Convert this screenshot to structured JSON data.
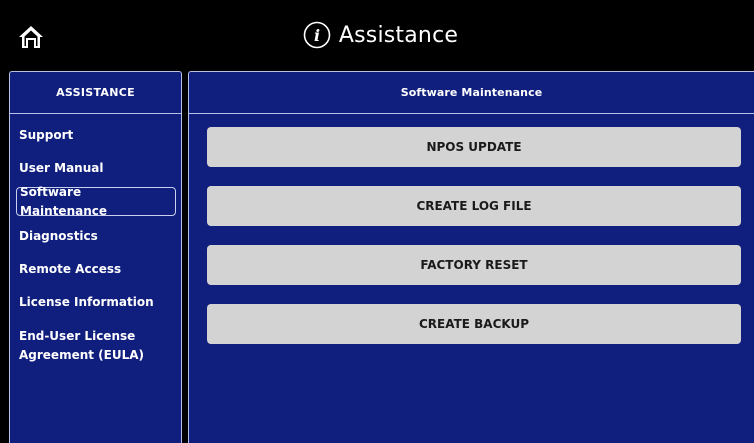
{
  "header": {
    "title": "Assistance",
    "home_icon": "home-icon",
    "info_icon": "info-icon"
  },
  "sidebar": {
    "title": "ASSISTANCE",
    "items": [
      {
        "label": "Support",
        "selected": false
      },
      {
        "label": "User Manual",
        "selected": false
      },
      {
        "label": "Software Maintenance",
        "selected": true
      },
      {
        "label": "Diagnostics",
        "selected": false
      },
      {
        "label": "Remote Access",
        "selected": false
      },
      {
        "label": "License Information",
        "selected": false
      },
      {
        "label": "End-User License Agreement (EULA)",
        "selected": false
      }
    ]
  },
  "main": {
    "title": "Software Maintenance",
    "buttons": [
      {
        "label": "NPOS UPDATE"
      },
      {
        "label": "CREATE LOG FILE"
      },
      {
        "label": "FACTORY RESET"
      },
      {
        "label": "CREATE BACKUP"
      }
    ]
  },
  "colors": {
    "background": "#000000",
    "panel": "#101f7e",
    "panel_border": "#b9c0e6",
    "button": "#d3d3d3",
    "button_text": "#1a1a1a",
    "text": "#ffffff"
  }
}
